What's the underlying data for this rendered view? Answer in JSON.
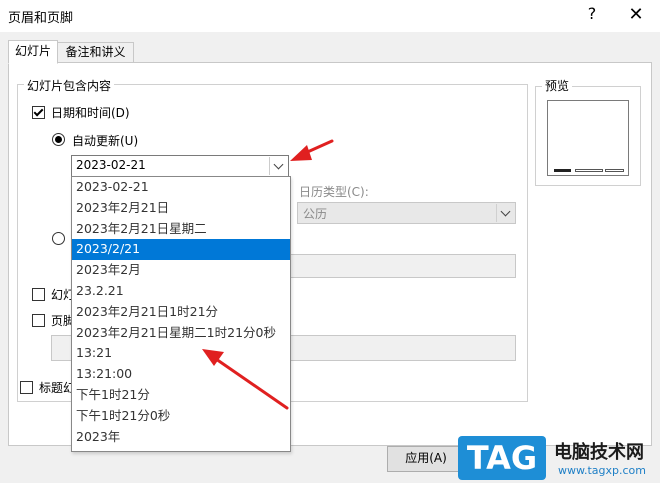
{
  "dialog": {
    "title": "页眉和页脚",
    "help_glyph": "?",
    "close_glyph": "✕"
  },
  "tabs": [
    {
      "label": "幻灯片",
      "active": true
    },
    {
      "label": "备注和讲义",
      "active": false
    }
  ],
  "group": {
    "legend": "幻灯片包含内容"
  },
  "date_time": {
    "label": "日期和时间(D)",
    "checked": true
  },
  "auto_update": {
    "label": "自动更新(U)",
    "selected": true,
    "value": "2023-02-21"
  },
  "calendar_type": {
    "label": "日历类型(C):",
    "value": "公历"
  },
  "fixed_radio": {
    "selected": false
  },
  "slide_number": {
    "label_partial": "幻灯"
  },
  "footer": {
    "label_partial": "页脚"
  },
  "title_slide": {
    "label_partial": "标题幻"
  },
  "dropdown_options": [
    "2023-02-21",
    "2023年2月21日",
    "2023年2月21日星期二",
    "2023/2/21",
    "2023年2月",
    "23.2.21",
    "2023年2月21日1时21分",
    "2023年2月21日星期二1时21分0秒",
    "13:21",
    "13:21:00",
    "下午1时21分",
    "下午1时21分0秒",
    "2023年"
  ],
  "dropdown_selected_index": 3,
  "preview": {
    "label": "预览"
  },
  "buttons": {
    "apply": "应用(A)"
  },
  "colors": {
    "accent": "#0078d7",
    "arrow": "#e02020",
    "watermark_blue": "#1e8ed6"
  },
  "watermark": {
    "tag": "TAG",
    "text": "电脑技术网",
    "url": "www.tagxp.com"
  }
}
